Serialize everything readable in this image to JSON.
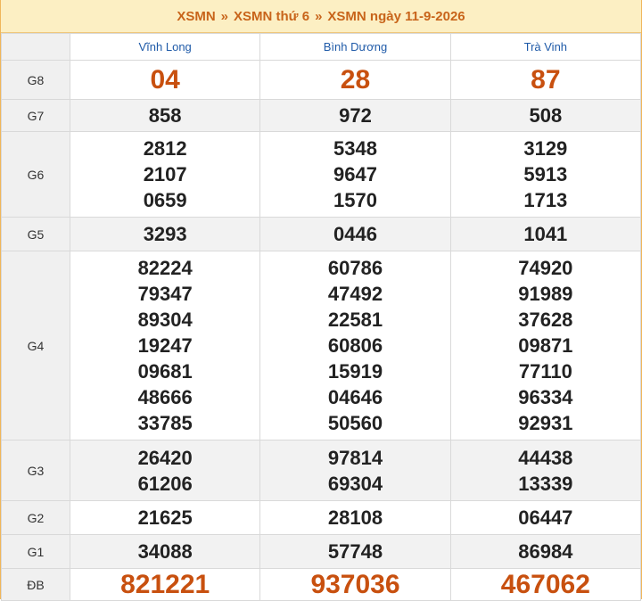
{
  "header": {
    "crumb1": "XSMN",
    "crumb2": "XSMN thứ 6",
    "crumb3": "XSMN ngày 11-9-2026",
    "separator": "»"
  },
  "provinces": [
    "Vĩnh Long",
    "Bình Dương",
    "Trà Vinh"
  ],
  "rows": [
    {
      "label": "G8",
      "values": [
        [
          "04"
        ],
        [
          "28"
        ],
        [
          "87"
        ]
      ]
    },
    {
      "label": "G7",
      "values": [
        [
          "858"
        ],
        [
          "972"
        ],
        [
          "508"
        ]
      ]
    },
    {
      "label": "G6",
      "values": [
        [
          "2812",
          "2107",
          "0659"
        ],
        [
          "5348",
          "9647",
          "1570"
        ],
        [
          "3129",
          "5913",
          "1713"
        ]
      ]
    },
    {
      "label": "G5",
      "values": [
        [
          "3293"
        ],
        [
          "0446"
        ],
        [
          "1041"
        ]
      ]
    },
    {
      "label": "G4",
      "values": [
        [
          "82224",
          "79347",
          "89304",
          "19247",
          "09681",
          "48666",
          "33785"
        ],
        [
          "60786",
          "47492",
          "22581",
          "60806",
          "15919",
          "04646",
          "50560"
        ],
        [
          "74920",
          "91989",
          "37628",
          "09871",
          "77110",
          "96334",
          "92931"
        ]
      ]
    },
    {
      "label": "G3",
      "values": [
        [
          "26420",
          "61206"
        ],
        [
          "97814",
          "69304"
        ],
        [
          "44438",
          "13339"
        ]
      ]
    },
    {
      "label": "G2",
      "values": [
        [
          "21625"
        ],
        [
          "28108"
        ],
        [
          "06447"
        ]
      ]
    },
    {
      "label": "G1",
      "values": [
        [
          "34088"
        ],
        [
          "57748"
        ],
        [
          "86984"
        ]
      ]
    },
    {
      "label": "ĐB",
      "values": [
        [
          "821221"
        ],
        [
          "937036"
        ],
        [
          "467062"
        ]
      ]
    }
  ]
}
